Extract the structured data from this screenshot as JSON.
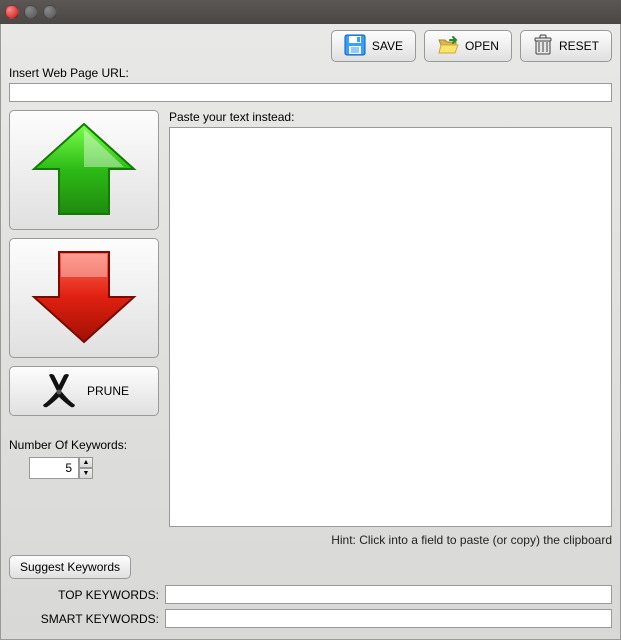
{
  "toolbar": {
    "save_label": "SAVE",
    "open_label": "OPEN",
    "reset_label": "RESET"
  },
  "url": {
    "label": "Insert Web Page URL:",
    "value": ""
  },
  "paste": {
    "label": "Paste your text instead:",
    "value": ""
  },
  "prune_label": "PRUNE",
  "num_keywords": {
    "label": "Number Of Keywords:",
    "value": "5"
  },
  "hint": "Hint: Click into a field to paste (or copy) the clipboard",
  "suggest_label": "Suggest Keywords",
  "top_kw": {
    "label": "TOP KEYWORDS:",
    "value": ""
  },
  "smart_kw": {
    "label": "SMART KEYWORDS:",
    "value": ""
  }
}
